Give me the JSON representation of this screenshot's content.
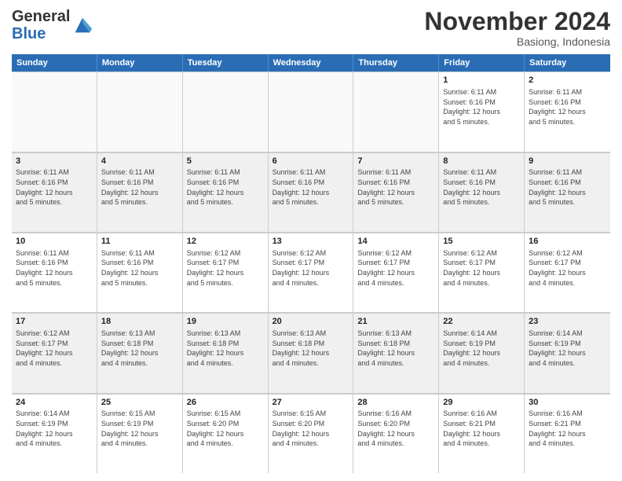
{
  "logo": {
    "general": "General",
    "blue": "Blue"
  },
  "header": {
    "month": "November 2024",
    "location": "Basiong, Indonesia"
  },
  "days": [
    "Sunday",
    "Monday",
    "Tuesday",
    "Wednesday",
    "Thursday",
    "Friday",
    "Saturday"
  ],
  "weeks": [
    [
      {
        "day": "",
        "detail": ""
      },
      {
        "day": "",
        "detail": ""
      },
      {
        "day": "",
        "detail": ""
      },
      {
        "day": "",
        "detail": ""
      },
      {
        "day": "",
        "detail": ""
      },
      {
        "day": "1",
        "detail": "Sunrise: 6:11 AM\nSunset: 6:16 PM\nDaylight: 12 hours\nand 5 minutes."
      },
      {
        "day": "2",
        "detail": "Sunrise: 6:11 AM\nSunset: 6:16 PM\nDaylight: 12 hours\nand 5 minutes."
      }
    ],
    [
      {
        "day": "3",
        "detail": "Sunrise: 6:11 AM\nSunset: 6:16 PM\nDaylight: 12 hours\nand 5 minutes."
      },
      {
        "day": "4",
        "detail": "Sunrise: 6:11 AM\nSunset: 6:16 PM\nDaylight: 12 hours\nand 5 minutes."
      },
      {
        "day": "5",
        "detail": "Sunrise: 6:11 AM\nSunset: 6:16 PM\nDaylight: 12 hours\nand 5 minutes."
      },
      {
        "day": "6",
        "detail": "Sunrise: 6:11 AM\nSunset: 6:16 PM\nDaylight: 12 hours\nand 5 minutes."
      },
      {
        "day": "7",
        "detail": "Sunrise: 6:11 AM\nSunset: 6:16 PM\nDaylight: 12 hours\nand 5 minutes."
      },
      {
        "day": "8",
        "detail": "Sunrise: 6:11 AM\nSunset: 6:16 PM\nDaylight: 12 hours\nand 5 minutes."
      },
      {
        "day": "9",
        "detail": "Sunrise: 6:11 AM\nSunset: 6:16 PM\nDaylight: 12 hours\nand 5 minutes."
      }
    ],
    [
      {
        "day": "10",
        "detail": "Sunrise: 6:11 AM\nSunset: 6:16 PM\nDaylight: 12 hours\nand 5 minutes."
      },
      {
        "day": "11",
        "detail": "Sunrise: 6:11 AM\nSunset: 6:16 PM\nDaylight: 12 hours\nand 5 minutes."
      },
      {
        "day": "12",
        "detail": "Sunrise: 6:12 AM\nSunset: 6:17 PM\nDaylight: 12 hours\nand 5 minutes."
      },
      {
        "day": "13",
        "detail": "Sunrise: 6:12 AM\nSunset: 6:17 PM\nDaylight: 12 hours\nand 4 minutes."
      },
      {
        "day": "14",
        "detail": "Sunrise: 6:12 AM\nSunset: 6:17 PM\nDaylight: 12 hours\nand 4 minutes."
      },
      {
        "day": "15",
        "detail": "Sunrise: 6:12 AM\nSunset: 6:17 PM\nDaylight: 12 hours\nand 4 minutes."
      },
      {
        "day": "16",
        "detail": "Sunrise: 6:12 AM\nSunset: 6:17 PM\nDaylight: 12 hours\nand 4 minutes."
      }
    ],
    [
      {
        "day": "17",
        "detail": "Sunrise: 6:12 AM\nSunset: 6:17 PM\nDaylight: 12 hours\nand 4 minutes."
      },
      {
        "day": "18",
        "detail": "Sunrise: 6:13 AM\nSunset: 6:18 PM\nDaylight: 12 hours\nand 4 minutes."
      },
      {
        "day": "19",
        "detail": "Sunrise: 6:13 AM\nSunset: 6:18 PM\nDaylight: 12 hours\nand 4 minutes."
      },
      {
        "day": "20",
        "detail": "Sunrise: 6:13 AM\nSunset: 6:18 PM\nDaylight: 12 hours\nand 4 minutes."
      },
      {
        "day": "21",
        "detail": "Sunrise: 6:13 AM\nSunset: 6:18 PM\nDaylight: 12 hours\nand 4 minutes."
      },
      {
        "day": "22",
        "detail": "Sunrise: 6:14 AM\nSunset: 6:19 PM\nDaylight: 12 hours\nand 4 minutes."
      },
      {
        "day": "23",
        "detail": "Sunrise: 6:14 AM\nSunset: 6:19 PM\nDaylight: 12 hours\nand 4 minutes."
      }
    ],
    [
      {
        "day": "24",
        "detail": "Sunrise: 6:14 AM\nSunset: 6:19 PM\nDaylight: 12 hours\nand 4 minutes."
      },
      {
        "day": "25",
        "detail": "Sunrise: 6:15 AM\nSunset: 6:19 PM\nDaylight: 12 hours\nand 4 minutes."
      },
      {
        "day": "26",
        "detail": "Sunrise: 6:15 AM\nSunset: 6:20 PM\nDaylight: 12 hours\nand 4 minutes."
      },
      {
        "day": "27",
        "detail": "Sunrise: 6:15 AM\nSunset: 6:20 PM\nDaylight: 12 hours\nand 4 minutes."
      },
      {
        "day": "28",
        "detail": "Sunrise: 6:16 AM\nSunset: 6:20 PM\nDaylight: 12 hours\nand 4 minutes."
      },
      {
        "day": "29",
        "detail": "Sunrise: 6:16 AM\nSunset: 6:21 PM\nDaylight: 12 hours\nand 4 minutes."
      },
      {
        "day": "30",
        "detail": "Sunrise: 6:16 AM\nSunset: 6:21 PM\nDaylight: 12 hours\nand 4 minutes."
      }
    ]
  ]
}
